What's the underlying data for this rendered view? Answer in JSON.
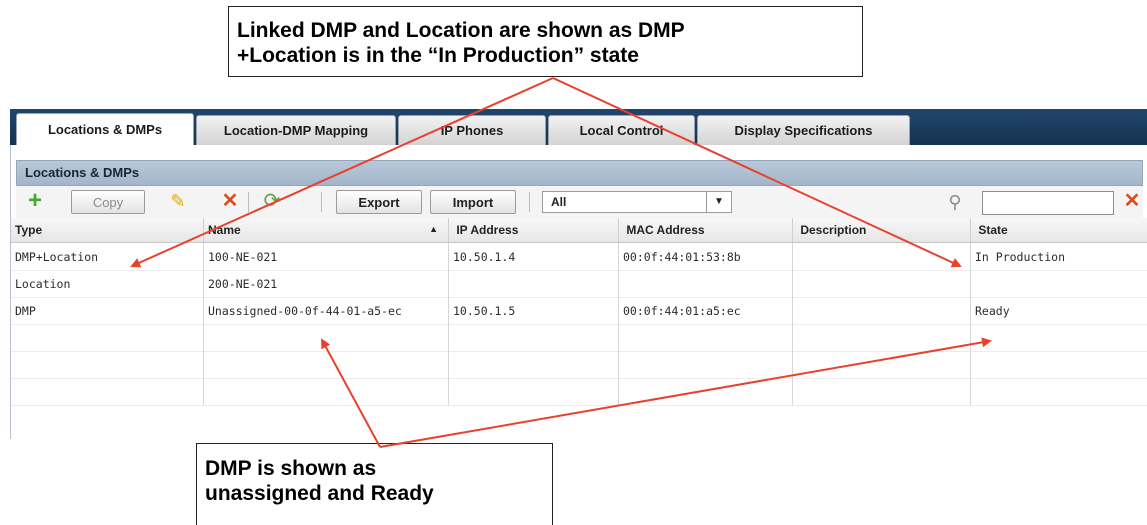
{
  "callouts": {
    "top": {
      "line1": "Linked DMP and Location are shown as DMP",
      "line2": "+Location is in the “In Production” state"
    },
    "bottom": {
      "line1": "DMP is shown as",
      "line2": "unassigned and Ready"
    }
  },
  "tabs": [
    {
      "label": "Locations & DMPs",
      "active": true
    },
    {
      "label": "Location-DMP Mapping",
      "active": false
    },
    {
      "label": "IP Phones",
      "active": false
    },
    {
      "label": "Local Control",
      "active": false
    },
    {
      "label": "Display Specifications",
      "active": false
    }
  ],
  "panel": {
    "title": "Locations & DMPs"
  },
  "toolbar": {
    "copy_label": "Copy",
    "export_label": "Export",
    "import_label": "Import",
    "filter_value": "All",
    "search_value": ""
  },
  "table": {
    "columns": [
      "Type",
      "Name",
      "IP Address",
      "MAC Address",
      "Description",
      "State"
    ],
    "sorted_column": "Name",
    "rows": [
      [
        "DMP+Location",
        "100-NE-021",
        "10.50.1.4",
        "00:0f:44:01:53:8b",
        "",
        "In Production"
      ],
      [
        "Location",
        "200-NE-021",
        "",
        "",
        "",
        ""
      ],
      [
        "DMP",
        "Unassigned-00-0f-44-01-a5-ec",
        "10.50.1.5",
        "00:0f:44:01:a5:ec",
        "",
        "Ready"
      ],
      [
        "",
        "",
        "",
        "",
        "",
        ""
      ],
      [
        "",
        "",
        "",
        "",
        "",
        ""
      ],
      [
        "",
        "",
        "",
        "",
        "",
        ""
      ]
    ]
  },
  "colors": {
    "arrow": "#e8412c",
    "tabbar": "#1b3c5e",
    "panel_header": "#adbfd1",
    "add_icon": "#4aa52e",
    "delete_icon": "#d9501f"
  },
  "icons": [
    "add-icon",
    "edit-pencil-icon",
    "delete-icon",
    "refresh-icon",
    "search-icon",
    "clear-search-icon"
  ]
}
